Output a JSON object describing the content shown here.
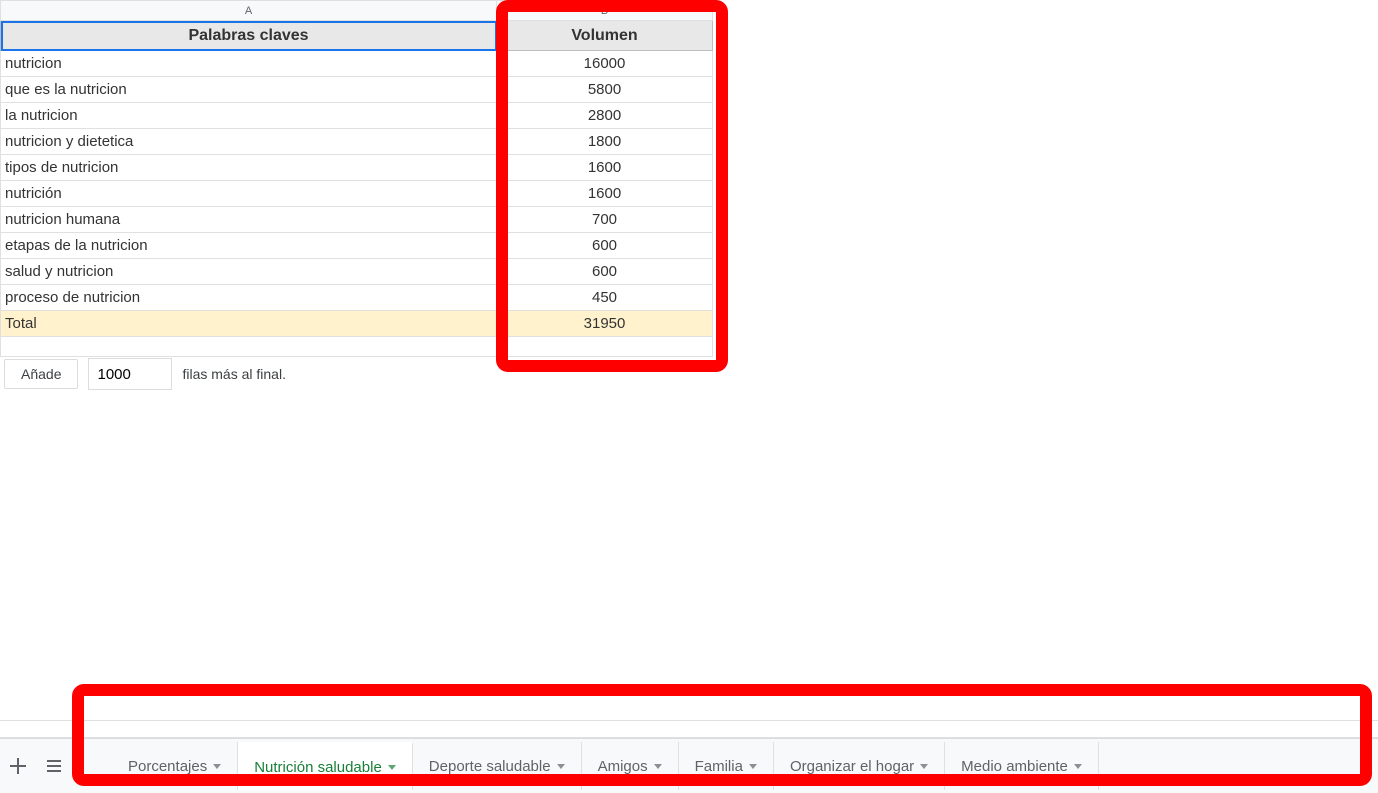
{
  "columns": {
    "A": "A",
    "B": "B"
  },
  "headers": {
    "keywords": "Palabras claves",
    "volume": "Volumen"
  },
  "rows": [
    {
      "kw": "nutricion",
      "vol": "16000"
    },
    {
      "kw": "que es la nutricion",
      "vol": "5800"
    },
    {
      "kw": "la nutricion",
      "vol": "2800"
    },
    {
      "kw": "nutricion y dietetica",
      "vol": "1800"
    },
    {
      "kw": "tipos de nutricion",
      "vol": "1600"
    },
    {
      "kw": "nutrición",
      "vol": "1600"
    },
    {
      "kw": "nutricion humana",
      "vol": "700"
    },
    {
      "kw": "etapas de la nutricion",
      "vol": "600"
    },
    {
      "kw": "salud y nutricion",
      "vol": "600"
    },
    {
      "kw": "proceso de nutricion",
      "vol": "450"
    }
  ],
  "total": {
    "label": "Total",
    "value": "31950"
  },
  "addRows": {
    "button": "Añade",
    "count": "1000",
    "suffix": "filas más al final."
  },
  "tabs": [
    {
      "label": "Porcentajes",
      "active": false
    },
    {
      "label": "Nutrición saludable",
      "active": true
    },
    {
      "label": "Deporte saludable",
      "active": false
    },
    {
      "label": "Amigos",
      "active": false
    },
    {
      "label": "Familia",
      "active": false
    },
    {
      "label": "Organizar el hogar",
      "active": false
    },
    {
      "label": "Medio ambiente",
      "active": false
    }
  ],
  "chart_data": {
    "type": "table",
    "columns": [
      "Palabras claves",
      "Volumen"
    ],
    "rows": [
      [
        "nutricion",
        16000
      ],
      [
        "que es la nutricion",
        5800
      ],
      [
        "la nutricion",
        2800
      ],
      [
        "nutricion y dietetica",
        1800
      ],
      [
        "tipos de nutricion",
        1600
      ],
      [
        "nutrición",
        1600
      ],
      [
        "nutricion humana",
        700
      ],
      [
        "etapas de la nutricion",
        600
      ],
      [
        "salud y nutricion",
        600
      ],
      [
        "proceso de nutricion",
        450
      ]
    ],
    "total": 31950
  }
}
